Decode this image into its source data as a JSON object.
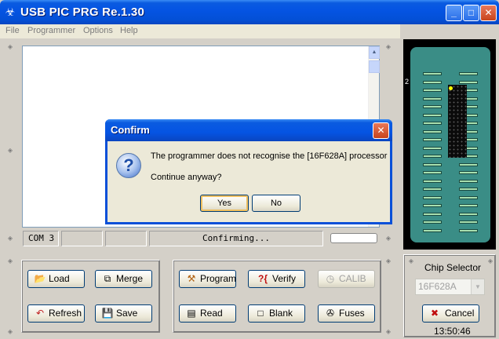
{
  "window": {
    "title": "USB PIC PRG Re.1.30",
    "min": "_",
    "max": "□",
    "close": "✕"
  },
  "menu": [
    "File",
    "Programmer",
    "Options",
    "Help"
  ],
  "status": {
    "port": "COM 3",
    "message": "Confirming...",
    "progress": 0
  },
  "chip_panel": {
    "pin1_marker": "2"
  },
  "buttons_left": {
    "load": "Load",
    "merge": "Merge",
    "refresh": "Refresh",
    "save": "Save"
  },
  "buttons_mid": {
    "program": "Program",
    "verify": "Verify",
    "calib": "CALIB",
    "read": "Read",
    "blank": "Blank",
    "fuses": "Fuses"
  },
  "chip_selector": {
    "label": "Chip Selector",
    "selected": "16F628A",
    "cancel": "Cancel",
    "time": "13:50:46"
  },
  "dialog": {
    "title": "Confirm",
    "message": "The programmer does not recognise the [16F628A] processor",
    "question": "Continue anyway?",
    "yes": "Yes",
    "no": "No",
    "icon_glyph": "?"
  },
  "icons": {
    "app": "☣",
    "load": "📂",
    "merge": "⧉",
    "refresh": "↶",
    "save": "💾",
    "program": "⚒",
    "verify": "?{",
    "calib": "◷",
    "read": "▤",
    "blank": "□",
    "fuses": "✇",
    "cancel": "✖",
    "dropdown": "▼",
    "scroll_up": "▲",
    "splitter": "◈"
  }
}
